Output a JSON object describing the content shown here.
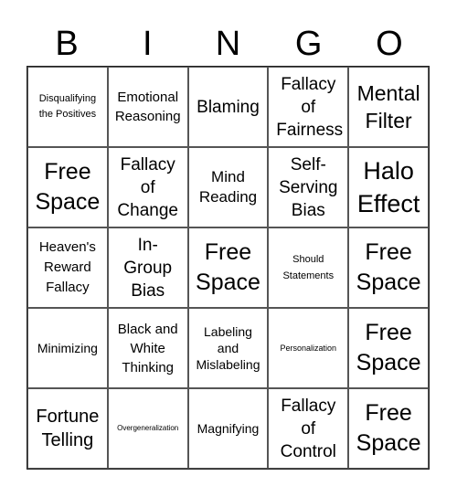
{
  "header": {
    "letters": [
      "B",
      "I",
      "N",
      "G",
      "O"
    ]
  },
  "cells": [
    {
      "text": "Disqualifying the Positives"
    },
    {
      "text": "Emotional Reasoning"
    },
    {
      "text": "Blaming"
    },
    {
      "text": "Fallacy of Fairness"
    },
    {
      "text": "Mental Filter"
    },
    {
      "text": "Free Space"
    },
    {
      "text": "Fallacy of Change"
    },
    {
      "text": "Mind Reading"
    },
    {
      "text": "Self-Serving Bias"
    },
    {
      "text": "Halo Effect"
    },
    {
      "text": "Heaven's Reward Fallacy"
    },
    {
      "text": "In-Group Bias"
    },
    {
      "text": "Free Space"
    },
    {
      "text": "Should Statements"
    },
    {
      "text": "Free Space"
    },
    {
      "text": "Minimizing"
    },
    {
      "text": "Black and White Thinking"
    },
    {
      "text": "Labeling and Mislabeling"
    },
    {
      "text": "Personalization"
    },
    {
      "text": "Free Space"
    },
    {
      "text": "Fortune Telling"
    },
    {
      "text": "Overgeneralization"
    },
    {
      "text": "Magnifying"
    },
    {
      "text": "Fallacy of Control"
    },
    {
      "text": "Free Space"
    }
  ]
}
